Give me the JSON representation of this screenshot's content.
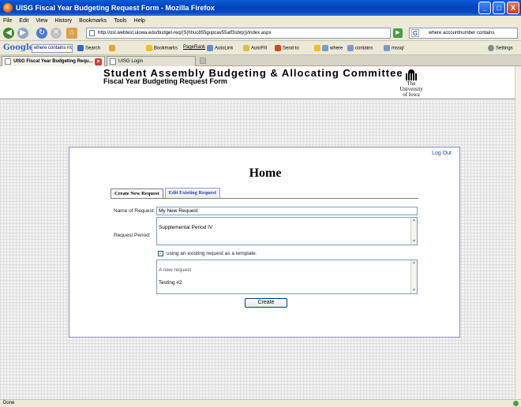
{
  "window": {
    "title": "UISG Fiscal Year Budgeting Request Form - Mozilla Firefox",
    "controls": {
      "minimize": "_",
      "maximize": "□",
      "close": "X"
    }
  },
  "menu": [
    "File",
    "Edit",
    "View",
    "History",
    "Bookmarks",
    "Tools",
    "Help"
  ],
  "nav": {
    "url": "http://osl.webtest.uiowa.edu/budget-req/(S(hhuc855gupcav55atf3sbrp))/index.aspx",
    "search_placeholder": "where accountnumber contains"
  },
  "google_toolbar": {
    "logo": "Google",
    "search_value": "where contains mx",
    "items": [
      "Search",
      "Bookmarks",
      "PageRank",
      "AutoLink",
      "AutoFill",
      "Send to",
      "where",
      "contains",
      "mssql"
    ],
    "settings": "Settings"
  },
  "browser_tabs": [
    {
      "label": "UISG Fiscal Year Budgeting Requ...",
      "active": true
    },
    {
      "label": "UISG Login",
      "active": false
    }
  ],
  "header": {
    "title": "Student Assembly Budgeting & Allocating Committee",
    "subtitle": "Fiscal Year Budgeting Request Form",
    "logo_line1": "The",
    "logo_line2": "University",
    "logo_line3": "of Iowa"
  },
  "panel": {
    "logout": "Log Out",
    "heading": "Home",
    "tabs": [
      {
        "label": "Create New Request",
        "active": true
      },
      {
        "label": "Edit Existing Request",
        "active": false
      }
    ],
    "form": {
      "name_label": "Name of Request:",
      "name_value": "My New Request",
      "period_label": "Request Period:",
      "period_value": "Supplemental Period IV",
      "template_checked": true,
      "template_label": "using an existing request as a template.",
      "template_list": [
        "A new request",
        "Testing #2"
      ],
      "create_button": "Create"
    }
  },
  "status": {
    "text": "Done"
  }
}
